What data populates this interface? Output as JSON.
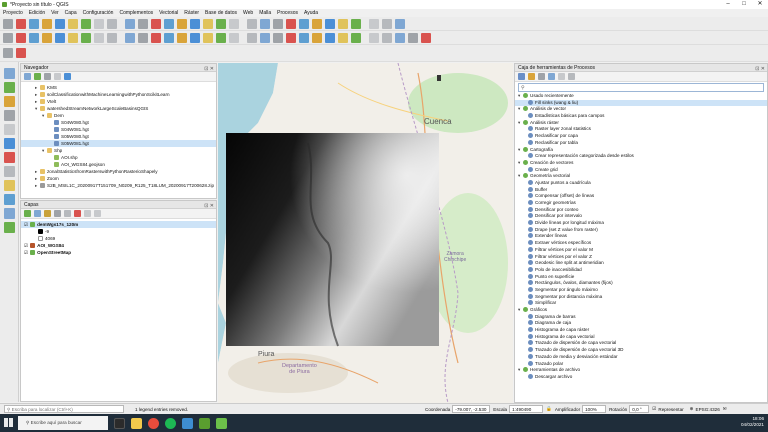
{
  "window": {
    "title": "*Proyecto sin título - QGIS"
  },
  "menu": [
    "Proyecto",
    "Edición",
    "Ver",
    "Capa",
    "Configuración",
    "Complementos",
    "Vectorial",
    "Ráster",
    "Base de datos",
    "Web",
    "Malla",
    "Procesos",
    "Ayuda"
  ],
  "navigator": {
    "title": "Navegador",
    "items": [
      {
        "label": "KMS",
        "depth": 2,
        "type": "folder",
        "open": false
      },
      {
        "label": "soilClassificationwithMachineLearningwithPythonScikitLearn",
        "depth": 2,
        "type": "folder",
        "open": false
      },
      {
        "label": "Vtelt",
        "depth": 2,
        "type": "folder",
        "open": false
      },
      {
        "label": "watershedStreamNetworkLargeScaleBasinsQGIS",
        "depth": 2,
        "type": "folder",
        "open": true
      },
      {
        "label": "Dem",
        "depth": 3,
        "type": "folder",
        "open": true
      },
      {
        "label": "S04W080.hgt",
        "depth": 4,
        "type": "raster"
      },
      {
        "label": "S04W081.hgt",
        "depth": 4,
        "type": "raster"
      },
      {
        "label": "S05W080.hgt",
        "depth": 4,
        "type": "raster"
      },
      {
        "label": "S05W081.hgt",
        "depth": 4,
        "type": "raster",
        "selected": true
      },
      {
        "label": "Shp",
        "depth": 3,
        "type": "folder",
        "open": true
      },
      {
        "label": "AOI.shp",
        "depth": 4,
        "type": "vector"
      },
      {
        "label": "AOI_WGS84.geojson",
        "depth": 4,
        "type": "vector"
      },
      {
        "label": "zonalStatisticsfromRasterswithPythonRasterioShapely",
        "depth": 2,
        "type": "folder",
        "open": false
      },
      {
        "label": "Zoom",
        "depth": 2,
        "type": "folder",
        "open": false
      },
      {
        "label": "S2B_MSIL1C_20200917T151709_N0209_R125_T18LUM_20200917T200628.zip",
        "depth": 2,
        "type": "zip",
        "open": false
      }
    ]
  },
  "layers": {
    "title": "Capas",
    "items": [
      {
        "label": "demWgs17s_120m",
        "bold": true,
        "checked": true,
        "selected": true,
        "depth": 0
      },
      {
        "label": "-9",
        "depth": 2,
        "swatch": "#000000"
      },
      {
        "label": "4069",
        "depth": 2,
        "swatch": "#ffffff"
      },
      {
        "label": "AOI_WGS84",
        "bold": true,
        "checked": true,
        "depth": 0,
        "swatch": "#b5542a"
      },
      {
        "label": "OpenStreetMap",
        "bold": true,
        "checked": true,
        "depth": 0
      }
    ]
  },
  "map": {
    "labels": {
      "cuenca": "Cuenca",
      "zamora": "Zamora\nChinchipe",
      "piura": "Piura",
      "depto": "Departamento\nde Piura"
    }
  },
  "toolbox": {
    "title": "Caja de herramientas de Procesos",
    "search_value": "",
    "items": [
      {
        "label": "Usado recientemente",
        "depth": 0,
        "group": true
      },
      {
        "label": "Fill sinks (wang & liu)",
        "depth": 1,
        "selected": true
      },
      {
        "label": "Análisis de vector",
        "depth": 0,
        "group": true
      },
      {
        "label": "Estadísticas básicas para campos",
        "depth": 1
      },
      {
        "label": "Análisis ráster",
        "depth": 0,
        "group": true
      },
      {
        "label": "Raster layer zonal statistics",
        "depth": 1
      },
      {
        "label": "Reclasificar por capa",
        "depth": 1
      },
      {
        "label": "Reclasificar por tabla",
        "depth": 1
      },
      {
        "label": "Cartografía",
        "depth": 0,
        "group": true
      },
      {
        "label": "Crear representación categorizada desde estilos",
        "depth": 1
      },
      {
        "label": "Creación de vectores",
        "depth": 0,
        "group": true
      },
      {
        "label": "Create grid",
        "depth": 1
      },
      {
        "label": "Geometría vectorial",
        "depth": 0,
        "group": true
      },
      {
        "label": "Ajustar puntos a cuadrícula",
        "depth": 1
      },
      {
        "label": "Buffer",
        "depth": 1
      },
      {
        "label": "Compensar (offset) de líneas",
        "depth": 1
      },
      {
        "label": "Corregir geometrías",
        "depth": 1
      },
      {
        "label": "Densificar por conteo",
        "depth": 1
      },
      {
        "label": "Densificar por intervalo",
        "depth": 1
      },
      {
        "label": "Divide líneas por longitud máxima",
        "depth": 1
      },
      {
        "label": "Drape (set Z value from raster)",
        "depth": 1
      },
      {
        "label": "Extender líneas",
        "depth": 1
      },
      {
        "label": "Extraer vértices específicos",
        "depth": 1
      },
      {
        "label": "Filtrar vértices por el valor M",
        "depth": 1
      },
      {
        "label": "Filtrar vértices por el valor Z",
        "depth": 1
      },
      {
        "label": "Geodesic line split at antimeridian",
        "depth": 1
      },
      {
        "label": "Polo de inaccesibilidad",
        "depth": 1
      },
      {
        "label": "Punto en superficie",
        "depth": 1
      },
      {
        "label": "Rectángulos, óvalos, diamantes (fijos)",
        "depth": 1
      },
      {
        "label": "Segmentar por ángulo máximo",
        "depth": 1
      },
      {
        "label": "Segmentar por distancia máxima",
        "depth": 1
      },
      {
        "label": "Simplificar",
        "depth": 1
      },
      {
        "label": "Gráficos",
        "depth": 0,
        "group": true
      },
      {
        "label": "Diagrama de barras",
        "depth": 1
      },
      {
        "label": "Diagrama de caja",
        "depth": 1
      },
      {
        "label": "Histograma de capa ráster",
        "depth": 1
      },
      {
        "label": "Histograma de capa vectorial",
        "depth": 1
      },
      {
        "label": "Trazado de dispersión de capa vectorial",
        "depth": 1
      },
      {
        "label": "Trazado de dispersión de capa vectorial 3D",
        "depth": 1
      },
      {
        "label": "Trazado de media y desviación estándar",
        "depth": 1
      },
      {
        "label": "Trazado polar",
        "depth": 1
      },
      {
        "label": "Herramientas de archivo",
        "depth": 0,
        "group": true
      },
      {
        "label": "Descargar archivo",
        "depth": 1
      }
    ]
  },
  "status": {
    "locator_placeholder": "Escriba para localizar (Ctrl+K)",
    "message": "1 legend entries removed.",
    "coord_label": "Coordenada",
    "coord_value": "-79.007, -2.530",
    "scale_label": "Escala",
    "scale_value": "1:490490",
    "magnifier_label": "Amplificador",
    "magnifier_value": "100%",
    "rotation_label": "Rotación",
    "rotation_value": "0,0 °",
    "render_label": "Representar",
    "crs": "EPSG:4326"
  },
  "taskbar": {
    "search_placeholder": "Escribe aquí para buscar",
    "time": "18:06",
    "date": "04/02/2021"
  }
}
